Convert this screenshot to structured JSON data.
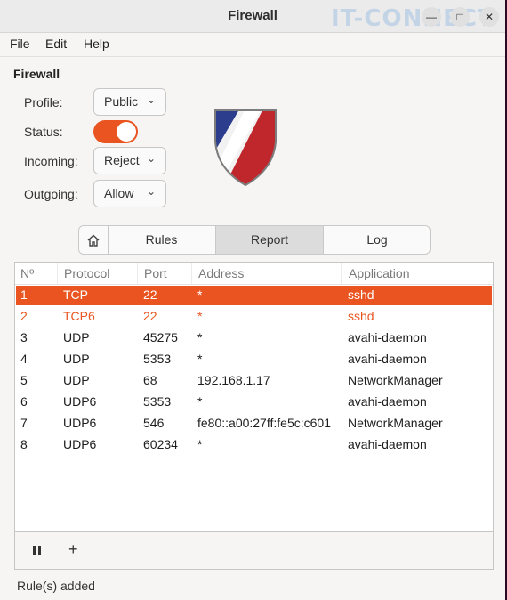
{
  "window": {
    "title": "Firewall",
    "watermark": "IT-CONNECT"
  },
  "menu": {
    "file": "File",
    "edit": "Edit",
    "help": "Help"
  },
  "section_title": "Firewall",
  "settings": {
    "profile_label": "Profile:",
    "profile_value": "Public",
    "status_label": "Status:",
    "status_on": true,
    "incoming_label": "Incoming:",
    "incoming_value": "Reject",
    "outgoing_label": "Outgoing:",
    "outgoing_value": "Allow"
  },
  "tabs": {
    "rules": "Rules",
    "report": "Report",
    "log": "Log",
    "active": "report"
  },
  "table": {
    "headers": [
      "Nº",
      "Protocol",
      "Port",
      "Address",
      "Application"
    ],
    "rows": [
      [
        "1",
        "TCP",
        "22",
        "*",
        "sshd"
      ],
      [
        "2",
        "TCP6",
        "22",
        "*",
        "sshd"
      ],
      [
        "3",
        "UDP",
        "45275",
        "*",
        "avahi-daemon"
      ],
      [
        "4",
        "UDP",
        "5353",
        "*",
        "avahi-daemon"
      ],
      [
        "5",
        "UDP",
        "68",
        "192.168.1.17",
        "NetworkManager"
      ],
      [
        "6",
        "UDP6",
        "5353",
        "*",
        "avahi-daemon"
      ],
      [
        "7",
        "UDP6",
        "546",
        "fe80::a00:27ff:fe5c:c601",
        "NetworkManager"
      ],
      [
        "8",
        "UDP6",
        "60234",
        "*",
        "avahi-daemon"
      ]
    ]
  },
  "status_text": "Rule(s) added",
  "colors": {
    "accent": "#e95420"
  },
  "icons": {
    "minimize": "minimize-icon",
    "maximize": "maximize-icon",
    "close": "close-icon",
    "home": "home-icon",
    "pause": "pause-icon",
    "add": "plus-icon"
  }
}
